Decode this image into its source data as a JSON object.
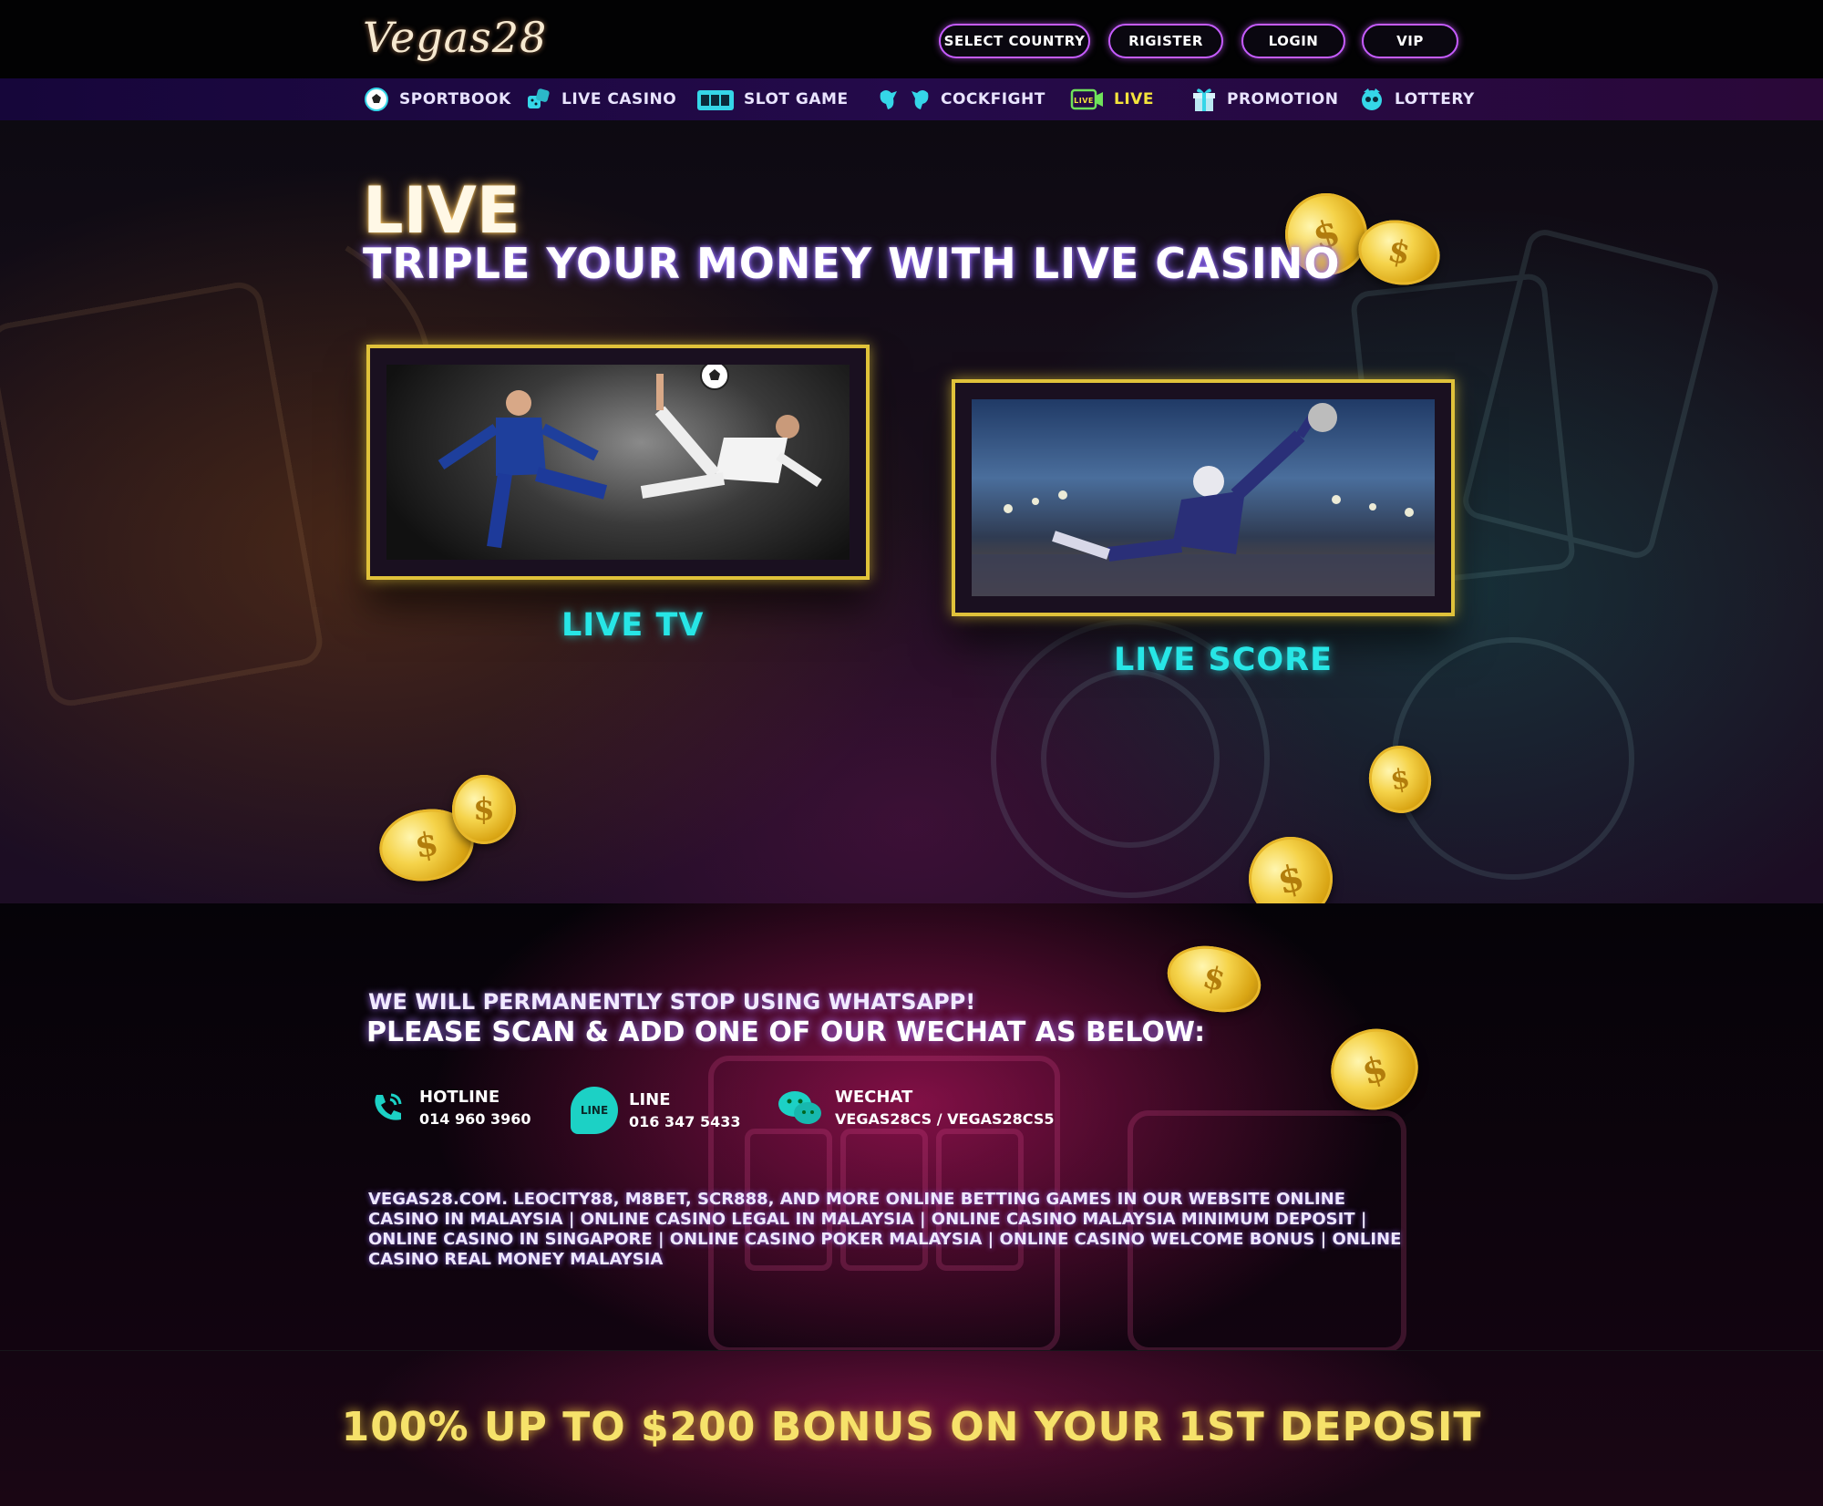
{
  "header": {
    "logo": "Vegas28",
    "buttons": {
      "select_country": "SELECT COUNTRY",
      "register": "RIGISTER",
      "login": "LOGIN",
      "vip": "VIP"
    }
  },
  "nav": {
    "items": [
      {
        "label": "SPORTBOOK",
        "icon": "soccer-ball-icon"
      },
      {
        "label": "LIVE CASINO",
        "icon": "dice-icon"
      },
      {
        "label": "SLOT GAME",
        "icon": "slot-machine-icon"
      },
      {
        "label": "COCKFIGHT",
        "icon": "rooster-icon"
      },
      {
        "label": "LIVE",
        "icon": "live-camera-icon",
        "active": true
      },
      {
        "label": "PROMOTION",
        "icon": "gift-icon"
      },
      {
        "label": "LOTTERY",
        "icon": "lottery-icon"
      }
    ]
  },
  "hero": {
    "title": "LIVE",
    "subtitle": "TRIPLE YOUR MONEY WITH LIVE CASINO",
    "cards": [
      {
        "caption": "LIVE TV",
        "image": "soccer-players-photo"
      },
      {
        "caption": "LIVE SCORE",
        "image": "goalkeeper-photo"
      }
    ]
  },
  "contact": {
    "notice_line1": "WE WILL PERMANENTLY STOP USING WHATSAPP!",
    "notice_line2": "PLEASE SCAN & ADD ONE OF OUR WECHAT AS BELOW:",
    "hotline": {
      "label": "HOTLINE",
      "value": "014 960 3960",
      "icon": "phone-icon"
    },
    "line": {
      "label": "LINE",
      "value": "016 347 5433",
      "icon": "line-icon",
      "icon_text": "LINE"
    },
    "wechat": {
      "label": "WECHAT",
      "value": "VEGAS28CS / VEGAS28CS5",
      "icon": "wechat-icon"
    }
  },
  "seo_text": "VEGAS28.COM. LEOCITY88, M8BET, SCR888, AND MORE ONLINE BETTING GAMES IN OUR WEBSITE ONLINE CASINO IN MALAYSIA | ONLINE CASINO LEGAL IN MALAYSIA | ONLINE CASINO MALAYSIA MINIMUM DEPOSIT | ONLINE CASINO IN SINGAPORE | ONLINE CASINO POKER MALAYSIA | ONLINE CASINO WELCOME BONUS | ONLINE CASINO REAL MONEY MALAYSIA",
  "bonus_text": "100% UP TO $200 BONUS ON YOUR 1ST DEPOSIT",
  "colors": {
    "accent_purple": "#c65cff",
    "active_nav": "#f3e33c",
    "caption_cyan": "#27e6e6",
    "card_border_gold": "#e0c23a",
    "bonus_yellow": "#f6e26a"
  }
}
